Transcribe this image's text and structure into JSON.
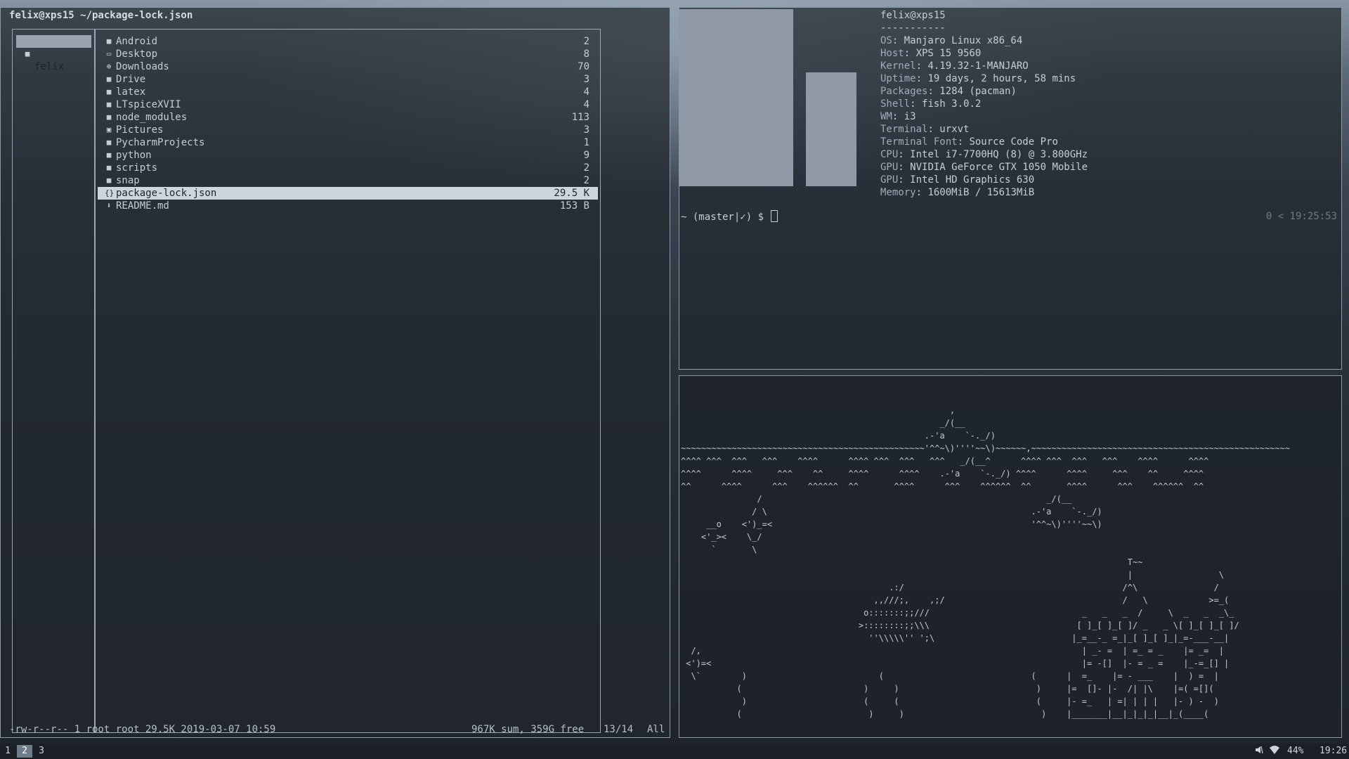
{
  "left_window": {
    "title": "felix@xps15 ~/package-lock.json",
    "parent_pane": {
      "label": "felix",
      "icon": "folder-icon"
    },
    "entries": [
      {
        "name": "Android",
        "size": "2",
        "icon": "folder-icon",
        "glyph": "■"
      },
      {
        "name": "Desktop",
        "size": "8",
        "icon": "desktop-icon",
        "glyph": "▭"
      },
      {
        "name": "Downloads",
        "size": "70",
        "icon": "download-icon",
        "glyph": "⊕"
      },
      {
        "name": "Drive",
        "size": "3",
        "icon": "folder-icon",
        "glyph": "■"
      },
      {
        "name": "latex",
        "size": "4",
        "icon": "folder-icon",
        "glyph": "■"
      },
      {
        "name": "LTspiceXVII",
        "size": "4",
        "icon": "folder-icon",
        "glyph": "■"
      },
      {
        "name": "node_modules",
        "size": "113",
        "icon": "folder-icon",
        "glyph": "■"
      },
      {
        "name": "Pictures",
        "size": "3",
        "icon": "image-icon",
        "glyph": "▣"
      },
      {
        "name": "PycharmProjects",
        "size": "1",
        "icon": "folder-icon",
        "glyph": "■"
      },
      {
        "name": "python",
        "size": "9",
        "icon": "folder-icon",
        "glyph": "■"
      },
      {
        "name": "scripts",
        "size": "2",
        "icon": "folder-icon",
        "glyph": "■"
      },
      {
        "name": "snap",
        "size": "2",
        "icon": "folder-icon",
        "glyph": "■"
      },
      {
        "name": "package-lock.json",
        "size": "29.5 K",
        "icon": "json-file-icon",
        "glyph": "{}",
        "selected": true
      },
      {
        "name": "README.md",
        "size": "153 B",
        "icon": "markdown-file-icon",
        "glyph": "⬇"
      }
    ],
    "status": {
      "permissions": "-rw-r--r-- 1 root root 29.5K 2019-03-07 10:59",
      "summary": "967K sum, 359G free",
      "position": "13/14",
      "scroll": "All"
    }
  },
  "neofetch": {
    "user_host": "felix@xps15",
    "separator": "-----------",
    "fields": [
      {
        "key": "OS",
        "value": "Manjaro Linux x86_64"
      },
      {
        "key": "Host",
        "value": "XPS 15 9560"
      },
      {
        "key": "Kernel",
        "value": "4.19.32-1-MANJARO"
      },
      {
        "key": "Uptime",
        "value": "19 days, 2 hours, 58 mins"
      },
      {
        "key": "Packages",
        "value": "1284 (pacman)"
      },
      {
        "key": "Shell",
        "value": "fish 3.0.2"
      },
      {
        "key": "WM",
        "value": "i3"
      },
      {
        "key": "Terminal",
        "value": "urxvt"
      },
      {
        "key": "Terminal Font",
        "value": "Source Code Pro"
      },
      {
        "key": "CPU",
        "value": "Intel i7-7700HQ (8) @ 3.800GHz"
      },
      {
        "key": "GPU",
        "value": "NVIDIA GeForce GTX 1050 Mobile"
      },
      {
        "key": "GPU",
        "value": "Intel HD Graphics 630"
      },
      {
        "key": "Memory",
        "value": "1600MiB / 15613MiB"
      }
    ],
    "prompt": "~ (master|✓) $",
    "prompt_right": "0 < 19:25:53"
  },
  "ascii_art": {
    "lines": [
      "                                                     ,",
      "                                                   _/(__",
      "                                                .-'a    `-._/)",
      "~~~~~~~~~~~~~~~~~~~~~~~~~~~~~~~~~~~~~~~~~~~~~~~~'^^~\\)''''~~\\)~~~~~~,~~~~~~~~~~~~~~~~~~~~~~~~~~~~~~~~~~~~~~~~~~~~~~~~~~~",
      "^^^^ ^^^  ^^^   ^^^    ^^^^      ^^^^ ^^^  ^^^   ^^^   _/(__^      ^^^^ ^^^  ^^^   ^^^    ^^^^      ^^^^",
      "^^^^      ^^^^     ^^^    ^^     ^^^^      ^^^^    .-'a    `-._/) ^^^^      ^^^^     ^^^    ^^     ^^^^",
      "^^      ^^^^      ^^^    ^^^^^^  ^^       ^^^^      ^^^    ^^^^^^  ^^       ^^^^      ^^^    ^^^^^^  ^^",
      "               /                                                        _/(__",
      "              / \\                                                    .-'a    `-._/)",
      "     __o    <')_=<                                                   '^^~\\)''''~~\\)",
      "    <'_><    \\_/",
      "      `       \\",
      "                                                                                        T~~",
      "                                                                                        |                 \\",
      "                                         .:/                                           /^\\               /",
      "                                      ,,///;,    ,;/                                   /   \\            >=_(",
      "                                    o:::::::;;///                              _   _   _  /     \\  _   _  _\\_",
      "                                   >::::::::;;\\\\\\                             [ ]_[ ]_[ ]/ _   _ \\[ ]_[ ]_[ ]/",
      "                                     ''\\\\\\\\\\'' ';\\                           |_=__-_ =_|_[ ]_[ ]_|_=-___-__|",
      "  /,                                                                           | _- =  | =_ = _    |= _=  |",
      " <')=<                                                                         |= -[]  |- = _ =    |_-=_[] |",
      "  \\`        )                          (                             (      |  =_    |= - ___    |  ) =  |",
      "           (                        )     )                           )     |=  []- |-  /| |\\    |=( =[](",
      "            )                       (     (                           (     |- =_   | =| | | |   |- ) -  )",
      "           (                         )     )                           )    |_______|__|_|_|_|__|_(____("
    ]
  },
  "bar": {
    "workspaces": [
      "1",
      "2",
      "3"
    ],
    "active_workspace": "2",
    "battery": "44%",
    "time": "19:26"
  }
}
